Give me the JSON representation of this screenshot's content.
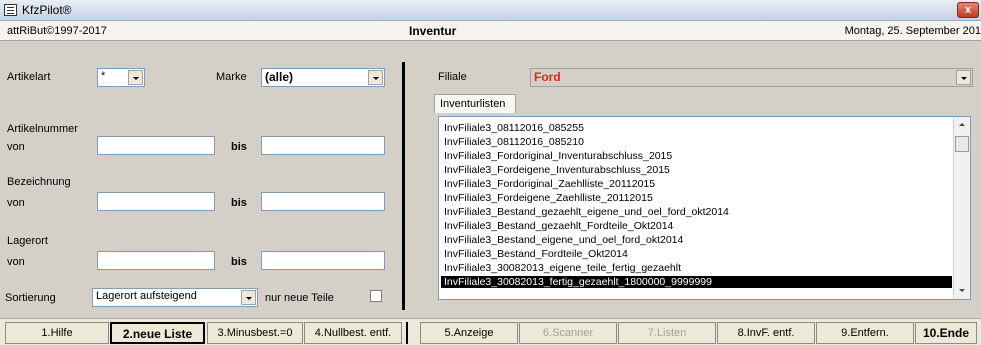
{
  "window": {
    "title": "KfzPilot®",
    "close_label": "x"
  },
  "header": {
    "copyright": "attRiBut©1997-2017",
    "title": "Inventur",
    "date": "Montag, 25. September 201"
  },
  "left": {
    "artikelart_label": "Artikelart",
    "artikelart_value": "*",
    "marke_label": "Marke",
    "marke_value": "(alle)",
    "artikelnummer_label": "Artikelnummer",
    "von": "von",
    "bis": "bis",
    "bezeichnung_label": "Bezeichnung",
    "lagerort_label": "Lagerort",
    "sortierung_label": "Sortierung",
    "sortierung_value": "Lagerort aufsteigend",
    "nur_neue_teile": "nur neue Teile"
  },
  "right": {
    "filiale_label": "Filiale",
    "filiale_value": "Ford",
    "tab_label": "Inventurlisten",
    "list": [
      "InvFiliale3_08112016_085255",
      "InvFiliale3_08112016_085210",
      "InvFiliale3_Fordoriginal_Inventurabschluss_2015",
      "InvFiliale3_Fordeigene_Inventurabschluss_2015",
      "InvFiliale3_Fordoriginal_Zaehlliste_20112015",
      "InvFiliale3_Fordeigene_Zaehlliste_20112015",
      "InvFiliale3_Bestand_gezaehlt_eigene_und_oel_ford_okt2014",
      "InvFiliale3_Bestand_gezaehlt_Fordteile_Okt2014",
      "InvFiliale3_Bestand_eigene_und_oel_ford_okt2014",
      "InvFiliale3_Bestand_Fordteile_Okt2014",
      "InvFiliale3_30082013_eigene_teile_fertig_gezaehlt",
      "InvFiliale3_30082013_fertig_gezaehlt_1800000_9999999"
    ],
    "selected_index": 11
  },
  "buttons": [
    "1.Hilfe",
    "2.neue Liste",
    "3.Minusbest.=0",
    "4.Nullbest. entf.",
    "5.Anzeige",
    "6.Scanner",
    "7.Listen",
    "8.InvF. entf.",
    "9.Entfern.",
    "10.Ende"
  ],
  "colors": {
    "accent_text": "#e8221a",
    "selection": "#000000"
  }
}
